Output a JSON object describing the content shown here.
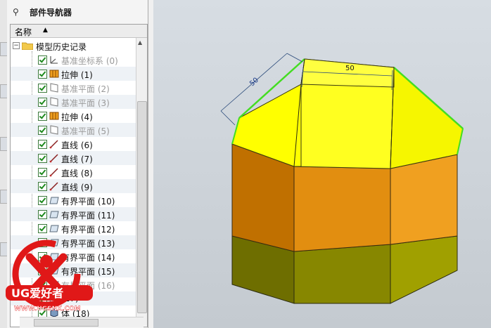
{
  "navigator": {
    "title": "部件导航器",
    "column_name": "名称",
    "root": "模型历史记录",
    "items": [
      {
        "label": "基准坐标系 (0)",
        "icon": "datum-csys-icon",
        "dim": true
      },
      {
        "label": "拉伸 (1)",
        "icon": "extrude-icon",
        "dim": false
      },
      {
        "label": "基准平面 (2)",
        "icon": "datum-plane-icon",
        "dim": true
      },
      {
        "label": "基准平面 (3)",
        "icon": "datum-plane-icon",
        "dim": true
      },
      {
        "label": "拉伸 (4)",
        "icon": "extrude-icon",
        "dim": false
      },
      {
        "label": "基准平面 (5)",
        "icon": "datum-plane-icon",
        "dim": true
      },
      {
        "label": "直线 (6)",
        "icon": "line-icon",
        "dim": false
      },
      {
        "label": "直线 (7)",
        "icon": "line-icon",
        "dim": false
      },
      {
        "label": "直线 (8)",
        "icon": "line-icon",
        "dim": false
      },
      {
        "label": "直线 (9)",
        "icon": "line-icon",
        "dim": false
      },
      {
        "label": "有界平面 (10)",
        "icon": "bounded-plane-icon",
        "dim": false
      },
      {
        "label": "有界平面 (11)",
        "icon": "bounded-plane-icon",
        "dim": false
      },
      {
        "label": "有界平面 (12)",
        "icon": "bounded-plane-icon",
        "dim": false
      },
      {
        "label": "有界平面 (13)",
        "icon": "bounded-plane-icon",
        "dim": false
      },
      {
        "label": "有界平面 (14)",
        "icon": "bounded-plane-icon",
        "dim": false
      },
      {
        "label": "有界平面 (15)",
        "icon": "bounded-plane-icon",
        "dim": false
      },
      {
        "label": "有界平面 (16)",
        "icon": "bounded-plane-icon",
        "dim": true
      },
      {
        "label": "(17)",
        "icon": "bounded-plane-icon",
        "dim": false
      },
      {
        "label": "体 (18)",
        "icon": "body-icon",
        "dim": false
      }
    ]
  },
  "viewport": {
    "dimension_top": "50",
    "dimension_slant": "50",
    "colors": {
      "top": "#ffff00",
      "middle": "#e08a10",
      "bottom": "#8a8a00",
      "edge_highlight": "#44dd22"
    }
  },
  "watermark": {
    "brand": "UG爱好者",
    "url": "WWW.UGSNX.COM",
    "colors": {
      "ring": "#e01818",
      "text": "#ffffff"
    }
  }
}
